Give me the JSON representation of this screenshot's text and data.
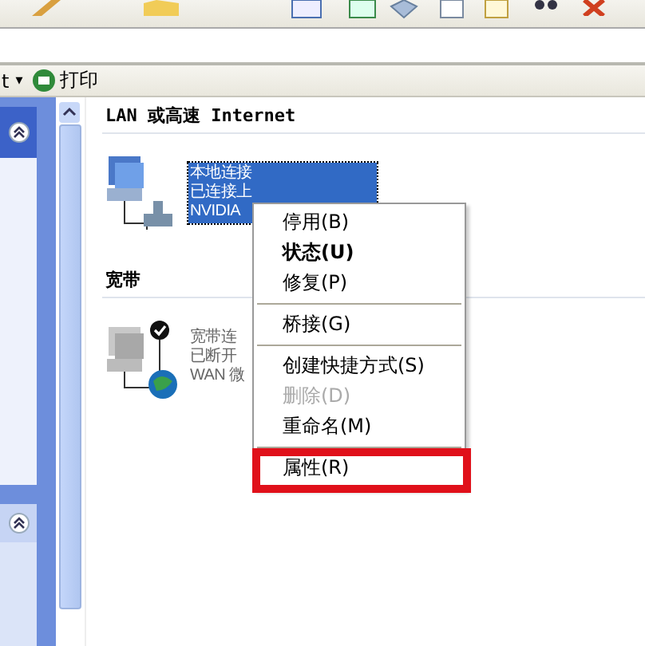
{
  "toolbar": {
    "menu_fragment": "t",
    "dropdown": "▾",
    "print": "打印"
  },
  "sections": [
    {
      "title": "LAN 或高速 Internet",
      "kind": "lan",
      "connection": {
        "lines": [
          "本地连接",
          "已连接上",
          "NVIDIA"
        ],
        "selected": true
      }
    },
    {
      "title": "宽带",
      "kind": "broadband",
      "connection": {
        "lines": [
          "宽带连",
          "已断开",
          "WAN 微"
        ],
        "selected": false
      }
    }
  ],
  "context_menu": {
    "items": [
      {
        "kind": "item",
        "label": "停用(B)",
        "bold": false,
        "disabled": false,
        "highlighted": false
      },
      {
        "kind": "item",
        "label": "状态(U)",
        "bold": true,
        "disabled": false,
        "highlighted": false
      },
      {
        "kind": "item",
        "label": "修复(P)",
        "bold": false,
        "disabled": false,
        "highlighted": false
      },
      {
        "kind": "separator"
      },
      {
        "kind": "item",
        "label": "桥接(G)",
        "bold": false,
        "disabled": false,
        "highlighted": false
      },
      {
        "kind": "separator"
      },
      {
        "kind": "item",
        "label": "创建快捷方式(S)",
        "bold": false,
        "disabled": false,
        "highlighted": false
      },
      {
        "kind": "item",
        "label": "删除(D)",
        "bold": false,
        "disabled": true,
        "highlighted": false
      },
      {
        "kind": "item",
        "label": "重命名(M)",
        "bold": false,
        "disabled": false,
        "highlighted": false
      },
      {
        "kind": "separator"
      },
      {
        "kind": "item",
        "label": "属性(R)",
        "bold": false,
        "disabled": false,
        "highlighted": true
      }
    ]
  }
}
